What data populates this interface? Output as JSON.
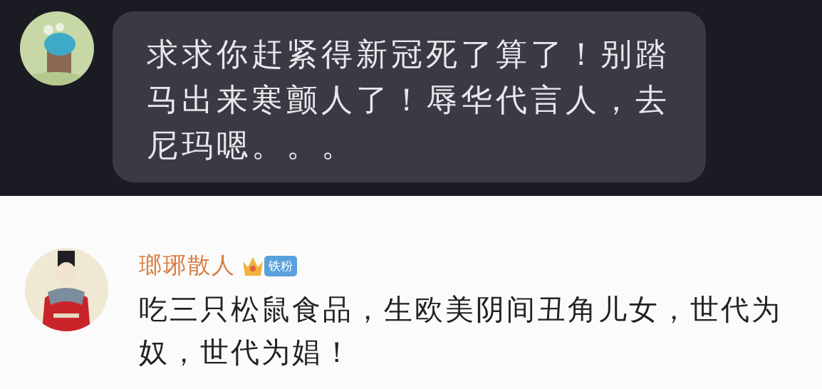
{
  "top_comment": {
    "text": "求求你赶紧得新冠死了算了！别踏马出来寒颤人了！辱华代言人，去尼玛嗯。。。"
  },
  "reply": {
    "username": "瑯琊散人",
    "badge": "铁粉",
    "text": "吃三只松鼠食品，生欧美阴间丑角儿女，世代为奴，世代为娼！"
  }
}
